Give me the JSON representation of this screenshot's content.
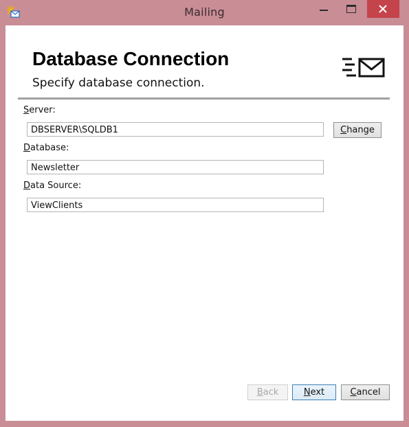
{
  "window": {
    "title": "Mailing",
    "app_icon": "app-icon",
    "controls": [
      "minimize-icon",
      "maximize-icon",
      "close-icon"
    ],
    "accent": "#c98d96",
    "close_color": "#c5434b"
  },
  "header": {
    "title": "Database Connection",
    "subtitle": "Specify database connection.",
    "icon": "mail-list-icon"
  },
  "form": {
    "server": {
      "label_mnemonic": "S",
      "label_rest": "erver:",
      "value": "DBSERVER\\SQLDB1"
    },
    "database": {
      "label_mnemonic": "D",
      "label_rest": "atabase:",
      "value": "Newsletter"
    },
    "data_source": {
      "label_mnemonic": "D",
      "label_rest": "ata Source:",
      "value": "ViewClients"
    },
    "change_button": {
      "mnemonic": "C",
      "rest": "hange"
    }
  },
  "footer": {
    "back": {
      "mnemonic": "B",
      "rest": "ack",
      "enabled": false
    },
    "next": {
      "mnemonic": "N",
      "rest": "ext"
    },
    "cancel": {
      "mnemonic": "C",
      "rest": "ancel"
    }
  }
}
